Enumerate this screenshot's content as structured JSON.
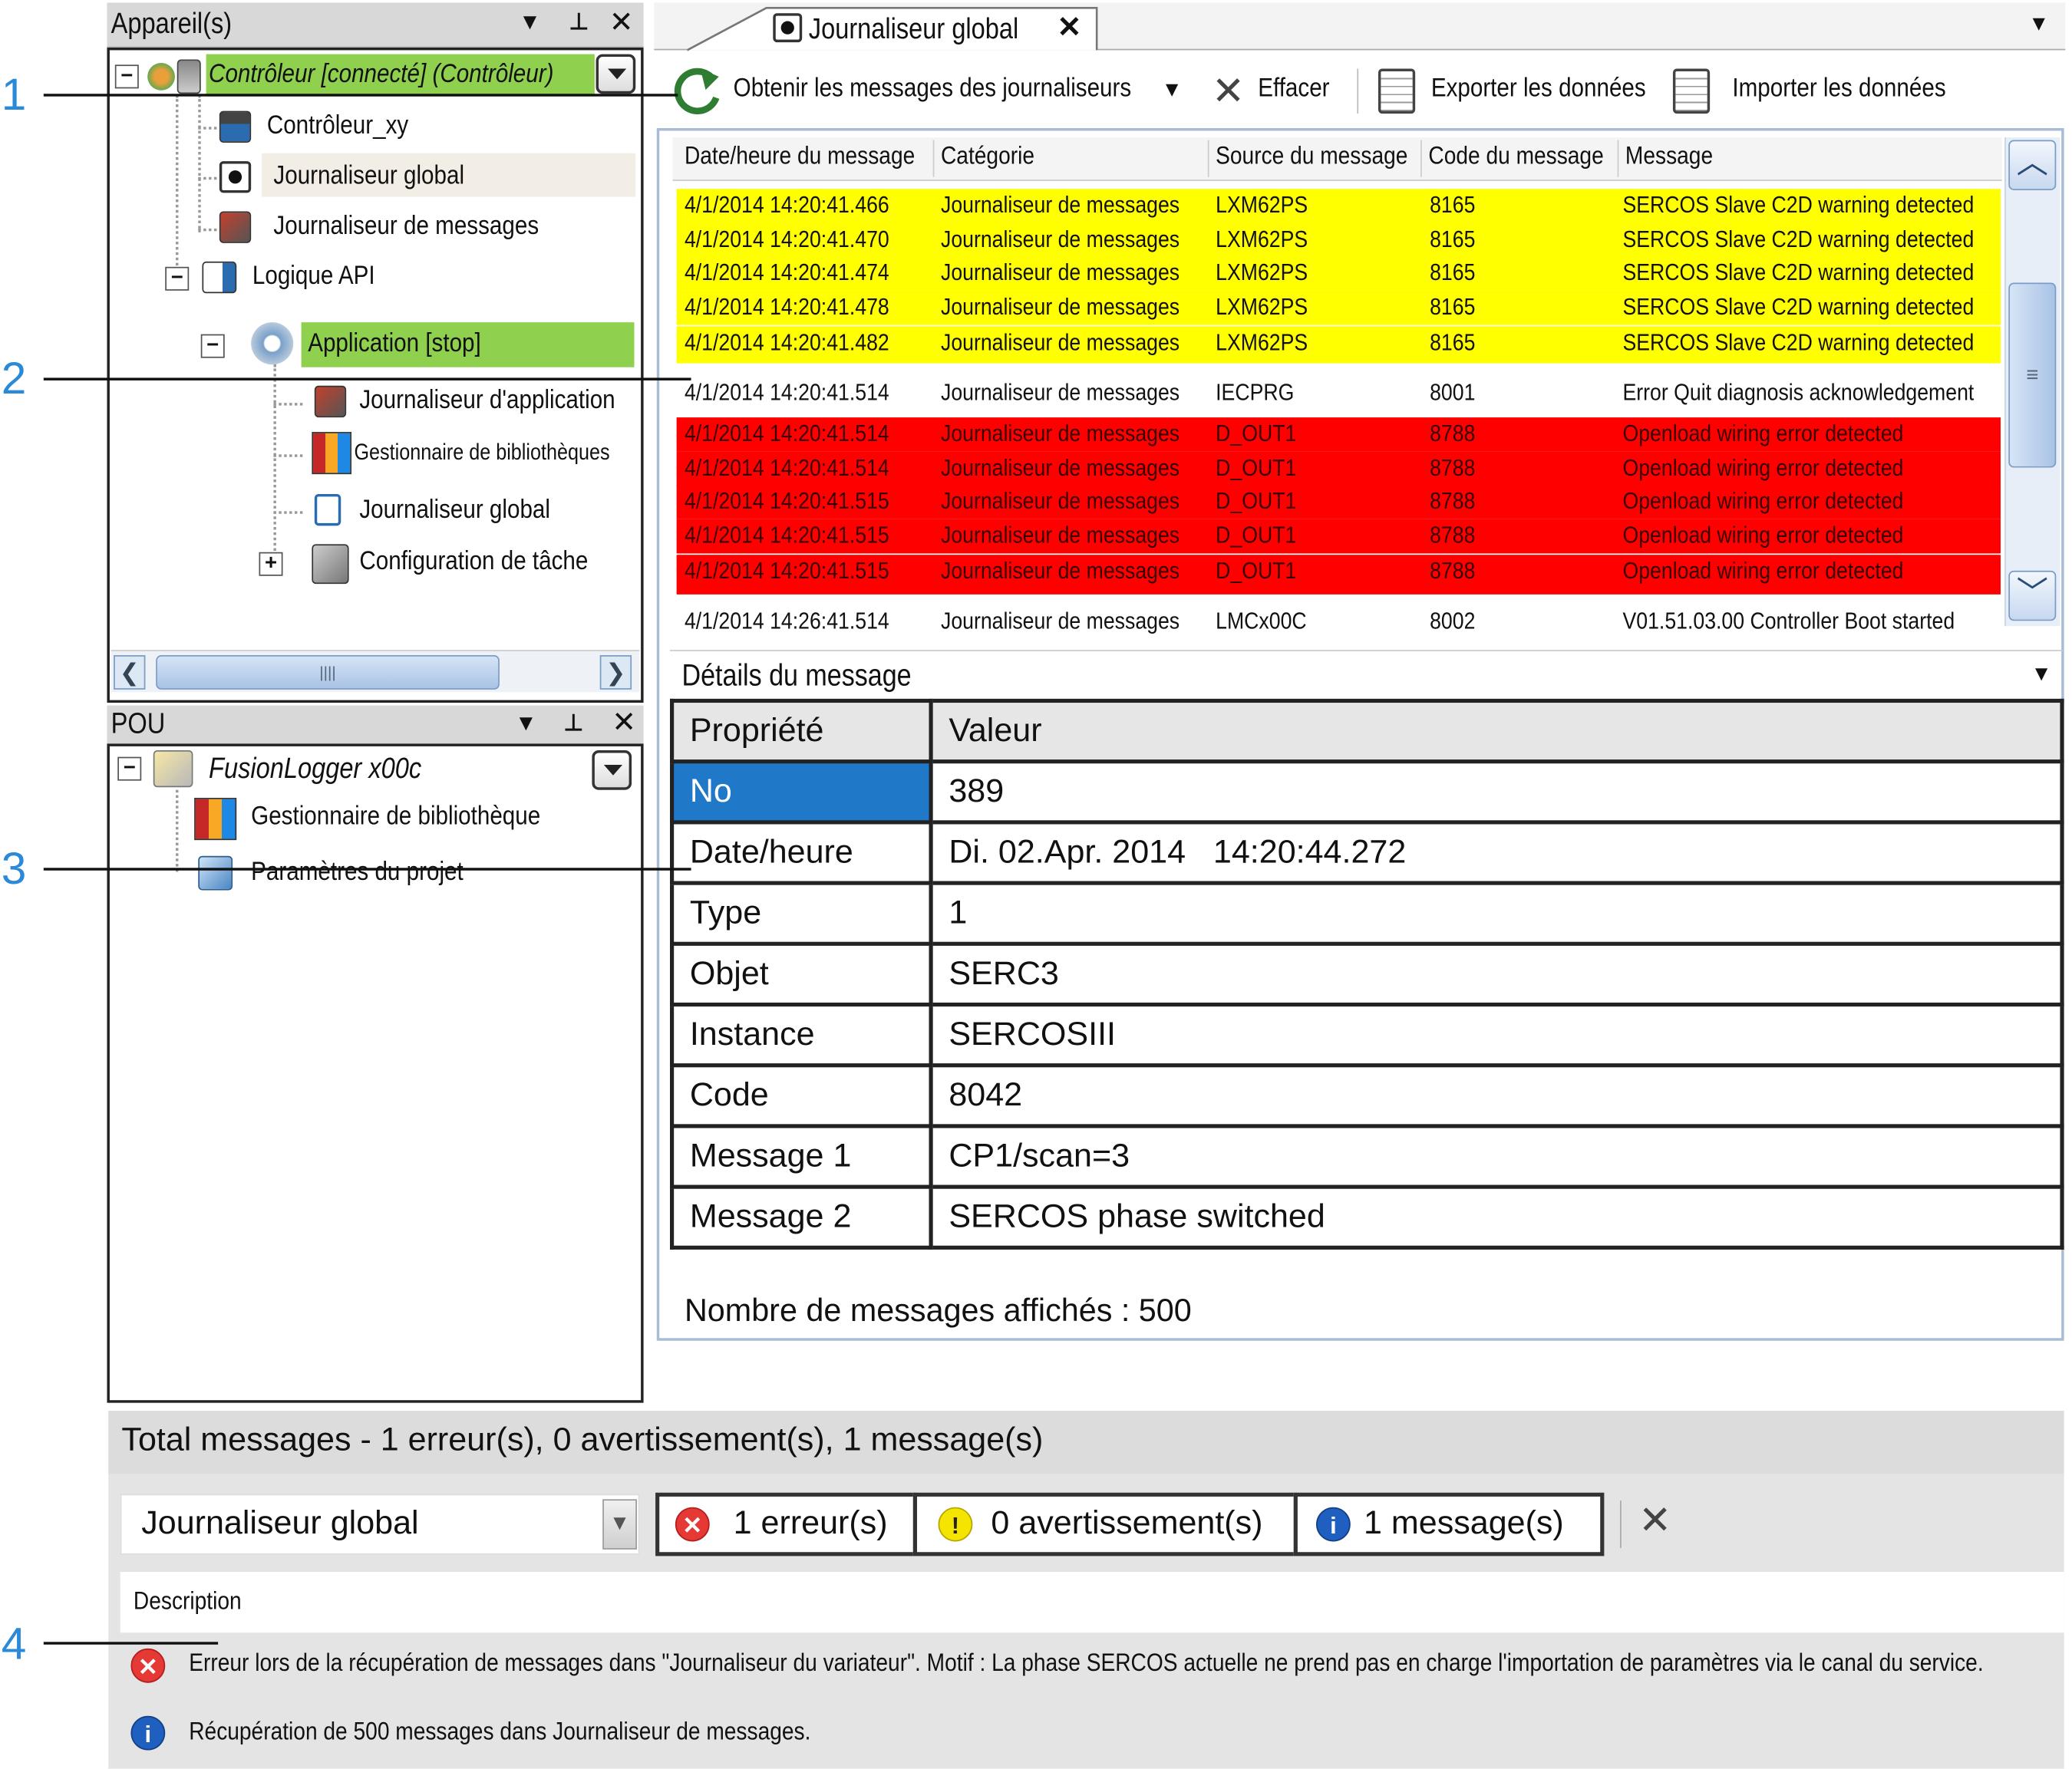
{
  "devices_panel": {
    "title": "Appareil(s)",
    "tree": {
      "controller": "Contrôleur [connecté] (Contrôleur)",
      "controller_xy": "Contrôleur_xy",
      "global_logger": "Journaliseur global",
      "message_logger": "Journaliseur de messages",
      "plc_logic": "Logique API",
      "application": "Application [stop]",
      "app_logger": "Journaliseur d'application",
      "library_manager": "Gestionnaire de bibliothèques",
      "global_logger_2": "Journaliseur global",
      "task_config": "Configuration de tâche"
    }
  },
  "pou_panel": {
    "title": "POU",
    "tree": {
      "root": "FusionLogger x00c",
      "library_manager": "Gestionnaire de bibliothèque",
      "project_settings": "Paramètres du projet"
    }
  },
  "editor": {
    "tab_label": "Journaliseur global",
    "toolbar": {
      "get_messages": "Obtenir les messages des journaliseurs",
      "clear": "Effacer",
      "export": "Exporter les données",
      "import": "Importer les données"
    },
    "columns": [
      "Date/heure du message",
      "Catégorie",
      "Source du message",
      "Code du message",
      "Message"
    ],
    "rows": [
      {
        "datetime": "4/1/2014  14:20:41.466",
        "category": "Journaliseur de messages",
        "source": "LXM62PS",
        "code": "8165",
        "message": "SERCOS Slave C2D warning detected",
        "style": "warning"
      },
      {
        "datetime": "4/1/2014  14:20:41.470",
        "category": "Journaliseur de messages",
        "source": "LXM62PS",
        "code": "8165",
        "message": "SERCOS Slave C2D warning detected",
        "style": "warning"
      },
      {
        "datetime": "4/1/2014  14:20:41.474",
        "category": "Journaliseur de messages",
        "source": "LXM62PS",
        "code": "8165",
        "message": "SERCOS Slave C2D warning detected",
        "style": "warning"
      },
      {
        "datetime": "4/1/2014  14:20:41.478",
        "category": "Journaliseur de messages",
        "source": "LXM62PS",
        "code": "8165",
        "message": "SERCOS Slave C2D warning detected",
        "style": "warning"
      },
      {
        "datetime": "4/1/2014  14:20:41.482",
        "category": "Journaliseur de messages",
        "source": "LXM62PS",
        "code": "8165",
        "message": "SERCOS Slave C2D warning detected",
        "style": "warning"
      },
      {
        "datetime": "4/1/2014  14:20:41.514",
        "category": "Journaliseur de messages",
        "source": "IECPRG",
        "code": "8001",
        "message": "Error Quit diagnosis acknowledgement",
        "style": "normal"
      },
      {
        "datetime": "4/1/2014  14:20:41.514",
        "category": "Journaliseur de messages",
        "source": "D_OUT1",
        "code": "8788",
        "message": "Openload wiring error detected",
        "style": "error"
      },
      {
        "datetime": "4/1/2014  14:20:41.514",
        "category": "Journaliseur de messages",
        "source": "D_OUT1",
        "code": "8788",
        "message": "Openload wiring error detected",
        "style": "error"
      },
      {
        "datetime": "4/1/2014  14:20:41.515",
        "category": "Journaliseur de messages",
        "source": "D_OUT1",
        "code": "8788",
        "message": "Openload wiring error detected",
        "style": "error"
      },
      {
        "datetime": "4/1/2014  14:20:41.515",
        "category": "Journaliseur de messages",
        "source": "D_OUT1",
        "code": "8788",
        "message": "Openload wiring error detected",
        "style": "error"
      },
      {
        "datetime": "4/1/2014  14:20:41.515",
        "category": "Journaliseur de messages",
        "source": "D_OUT1",
        "code": "8788",
        "message": "Openload wiring error detected",
        "style": "error"
      },
      {
        "datetime": "4/1/2014  14:26:41.514",
        "category": "Journaliseur de messages",
        "source": "LMCx00C",
        "code": "8002",
        "message": "V01.51.03.00 Controller Boot started",
        "style": "normal"
      }
    ],
    "details": {
      "title": "Détails du message",
      "header": {
        "property": "Propriété",
        "value": "Valeur"
      },
      "items": [
        {
          "property": "No",
          "value": "389"
        },
        {
          "property": "Date/heure",
          "value": "Di. 02.Apr. 2014   14:20:44.272"
        },
        {
          "property": "Type",
          "value": "1"
        },
        {
          "property": "Objet",
          "value": "SERC3"
        },
        {
          "property": "Instance",
          "value": "SERCOSIII"
        },
        {
          "property": "Code",
          "value": "8042"
        },
        {
          "property": "Message 1",
          "value": "CP1/scan=3"
        },
        {
          "property": "Message 2",
          "value": "SERCOS phase switched"
        }
      ]
    },
    "count_text": "Nombre de messages affichés : 500"
  },
  "messages_panel": {
    "summary": "Total messages - 1 erreur(s), 0 avertissement(s), 1 message(s)",
    "source_select": "Journaliseur global",
    "filters": {
      "errors": "1 erreur(s)",
      "warnings": "0 avertissement(s)",
      "messages": "1 message(s)"
    },
    "description_header": "Description",
    "entries": [
      {
        "type": "error",
        "text": "Erreur lors de la récupération de messages dans \"Journaliseur du variateur\". Motif : La phase SERCOS actuelle ne prend pas en charge l'importation de paramètres via le canal du service."
      },
      {
        "type": "info",
        "text": "Récupération de 500 messages dans Journaliseur de messages."
      }
    ]
  },
  "callouts": [
    "1",
    "2",
    "3",
    "4"
  ],
  "colors": {
    "warning_row": "#ffff00",
    "error_row": "#ff0000",
    "selected_green": "#8fd14f",
    "selected_blue": "#1f78c8",
    "callout": "#2b8ad8"
  }
}
